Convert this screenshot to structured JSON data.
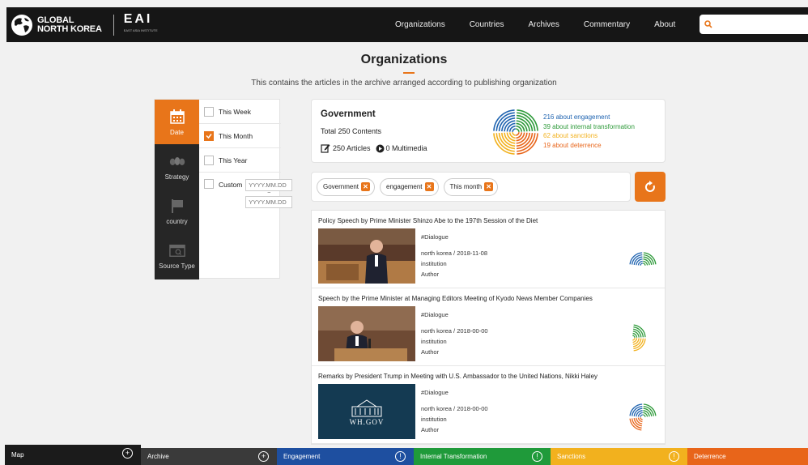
{
  "header": {
    "logo_line1": "GLOBAL",
    "logo_line2": "NORTH KOREA",
    "eai": "EAI",
    "eai_sub": "EAST ASIA INSTITUTE",
    "nav": [
      "Organizations",
      "Countries",
      "Archives",
      "Commentary",
      "About"
    ],
    "search_placeholder": ""
  },
  "page": {
    "title": "Organizations",
    "subtitle": "This contains the articles in the archive arranged according to publishing organization"
  },
  "filters": {
    "tabs": [
      {
        "label": "Date",
        "icon": "calendar-icon",
        "active": true
      },
      {
        "label": "Strategy",
        "icon": "strategy-icon",
        "active": false
      },
      {
        "label": "country",
        "icon": "flag-icon",
        "active": false
      },
      {
        "label": "Source Type",
        "icon": "source-type-icon",
        "active": false
      }
    ],
    "options": [
      {
        "label": "This Week",
        "checked": false
      },
      {
        "label": "This Month",
        "checked": true
      },
      {
        "label": "This Year",
        "checked": false
      }
    ],
    "custom_label": "Custom",
    "custom_from_placeholder": "YYYY.MM.DD",
    "custom_tilde": "~",
    "custom_to_placeholder": "YYYY.MM.DD"
  },
  "summary": {
    "org_name": "Government",
    "total": "Total 250 Contents",
    "articles": "250 Articles",
    "multimedia": "0 Multimedia",
    "legend": [
      {
        "text": "216 about engagement",
        "color": "#1e63b0"
      },
      {
        "text": "39 about internal transformation",
        "color": "#2e9a3a"
      },
      {
        "text": "62 about sanctions",
        "color": "#f2b11e"
      },
      {
        "text": "19 about deterrence",
        "color": "#e8651a"
      }
    ]
  },
  "active_tags": [
    "Government",
    "engagement",
    "This month"
  ],
  "articles": [
    {
      "title": "Policy Speech by Prime Minister Shinzo Abe to the 197th Session of the Diet",
      "tag": "#Dialogue",
      "line": "north korea / 2018-11-08",
      "institution": "institution",
      "author": "Author"
    },
    {
      "title": "Speech by the Prime Minister at Managing Editors Meeting of Kyodo News Member Companies",
      "tag": "#Dialogue",
      "line": "north korea / 2018-00-00",
      "institution": "institution",
      "author": "Author"
    },
    {
      "title": "Remarks by President Trump in Meeting with U.S. Ambassador to the United Nations, Nikki Haley",
      "tag": "#Dialogue",
      "line": "north korea / 2018-00-00",
      "institution": "institution",
      "author": "Author",
      "thumb_text": "WH.GOV"
    }
  ],
  "bottom_tabs": [
    {
      "label": "Map",
      "color": "#1b1b1b"
    },
    {
      "label": "Archive",
      "color": "#3a3a3a"
    },
    {
      "label": "Engagement",
      "color": "#1e4fa0"
    },
    {
      "label": "Internal Transformation",
      "color": "#1f9a3a"
    },
    {
      "label": "Sanctions",
      "color": "#f2b11e"
    },
    {
      "label": "Deterrence",
      "color": "#e8651a"
    }
  ]
}
